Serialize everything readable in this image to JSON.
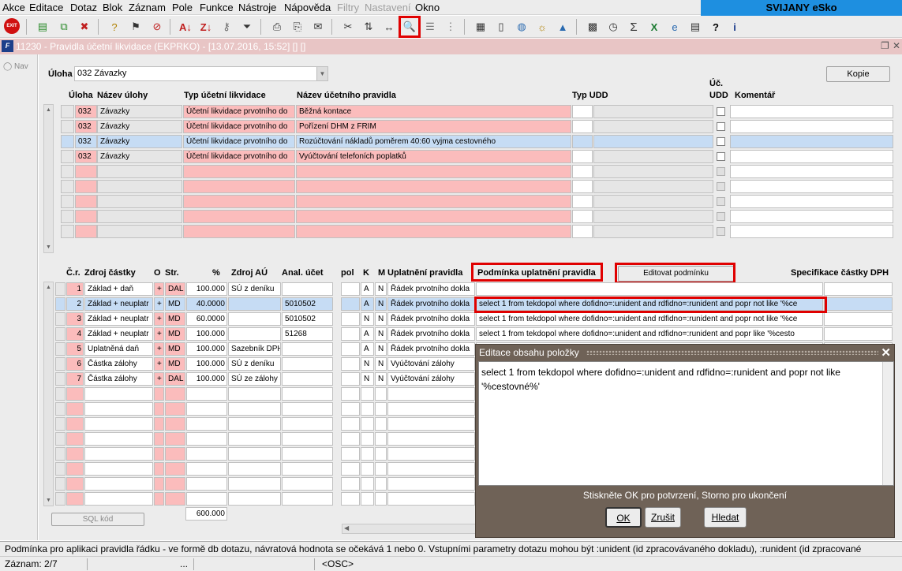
{
  "menu": [
    "Akce",
    "Editace",
    "Dotaz",
    "Blok",
    "Záznam",
    "Pole",
    "Funkce",
    "Nástroje",
    "Nápověda",
    "Filtry",
    "Nastavení",
    "Okno"
  ],
  "brand": "SVIJANY eSko",
  "window": {
    "title": "11230 - Pravidla účetní likvidace (EKPRKO) - [13.07.2016, 15:52]  []  []",
    "nav": "Nav"
  },
  "uloha": {
    "label": "Úloha",
    "value": "032 Závazky",
    "kopie": "Kopie"
  },
  "rules_table": {
    "headers": {
      "uloha": "Úloha",
      "nazev_ulohy": "Název úlohy",
      "typ": "Typ účetní likvidace",
      "nazev_pravidla": "Název účetního pravidla",
      "typ_udd": "Typ UDD",
      "uc_udd_1": "Úč.",
      "uc_udd_2": "UDD",
      "komentar": "Komentář"
    },
    "rows": [
      {
        "uloha": "032",
        "nazev": "Závazky",
        "typ": "Účetní likvidace prvotního do",
        "pravidlo": "Běžná kontace"
      },
      {
        "uloha": "032",
        "nazev": "Závazky",
        "typ": "Účetní likvidace prvotního do",
        "pravidlo": "Pořízení DHM z FRIM"
      },
      {
        "uloha": "032",
        "nazev": "Závazky",
        "typ": "Účetní likvidace prvotního do",
        "pravidlo": "Rozúčtování nákladů poměrem 40:60 vyjma cestovného"
      },
      {
        "uloha": "032",
        "nazev": "Závazky",
        "typ": "Účetní likvidace prvotního do",
        "pravidlo": "Vyúčtování telefoních poplatků"
      }
    ]
  },
  "lines_table": {
    "headers": {
      "cr": "Č.r.",
      "zdroj": "Zdroj částky",
      "o": "O",
      "str": "Str.",
      "pct": "%",
      "zdroj_au": "Zdroj AÚ",
      "anal": "Anal. účet",
      "pol": "pol",
      "k": "K",
      "m": "M",
      "uplatneni": "Uplatnění pravidla",
      "podminka": "Podmínka uplatnění pravidla",
      "editovat": "Editovat podmínku",
      "specifikace": "Specifikace částky DPH"
    },
    "rows": [
      {
        "cr": "1",
        "zdroj": "Základ + daň",
        "o": "+",
        "str": "DAL",
        "pct": "100.000",
        "zdroj_au": "SÚ z deníku",
        "anal": "",
        "k": "A",
        "m": "N",
        "upl": "Řádek prvotního dokla",
        "podm": ""
      },
      {
        "cr": "2",
        "zdroj": "Základ + neuplatr",
        "o": "+",
        "str": "MD",
        "pct": "40.0000",
        "zdroj_au": "",
        "anal": "5010502",
        "k": "A",
        "m": "N",
        "upl": "Řádek prvotního dokla",
        "podm": "select 1 from tekdopol where dofidno=:unident and rdfidno=:runident and popr not like '%ce"
      },
      {
        "cr": "3",
        "zdroj": "Základ + neuplatr",
        "o": "+",
        "str": "MD",
        "pct": "60.0000",
        "zdroj_au": "",
        "anal": "5010502",
        "k": "N",
        "m": "N",
        "upl": "Řádek prvotního dokla",
        "podm": "select 1 from tekdopol where dofidno=:unident and rdfidno=:runident and popr not like '%ce"
      },
      {
        "cr": "4",
        "zdroj": "Základ + neuplatr",
        "o": "+",
        "str": "MD",
        "pct": "100.000",
        "zdroj_au": "",
        "anal": "51268",
        "k": "A",
        "m": "N",
        "upl": "Řádek prvotního dokla",
        "podm": "select 1 from tekdopol where dofidno=:unident and rdfidno=:runident and popr like '%cesto"
      },
      {
        "cr": "5",
        "zdroj": "Uplatněná daň",
        "o": "+",
        "str": "MD",
        "pct": "100.000",
        "zdroj_au": "Sazebník DPH",
        "anal": "",
        "k": "A",
        "m": "N",
        "upl": "Řádek prvotního dokla",
        "podm": ""
      },
      {
        "cr": "6",
        "zdroj": "Částka zálohy",
        "o": "+",
        "str": "MD",
        "pct": "100.000",
        "zdroj_au": "SÚ z deníku",
        "anal": "",
        "k": "N",
        "m": "N",
        "upl": "Vyúčtování zálohy",
        "podm": ""
      },
      {
        "cr": "7",
        "zdroj": "Částka zálohy",
        "o": "+",
        "str": "DAL",
        "pct": "100.000",
        "zdroj_au": "SÚ ze zálohy",
        "anal": "",
        "k": "N",
        "m": "N",
        "upl": "Vyúčtování zálohy",
        "podm": ""
      }
    ],
    "sum": "600.000",
    "sql_button": "SQL kód"
  },
  "popup": {
    "title": "Editace obsahu položky",
    "text": "select 1 from tekdopol where dofidno=:unident and rdfidno=:runident and popr not like '%cestovné%'",
    "message": "Stiskněte OK pro potvrzení, Storno pro ukončení",
    "ok": "OK",
    "cancel": "Zrušit",
    "find": "Hledat"
  },
  "status": {
    "hint": "Podmínka pro aplikaci pravidla řádku - ve formě db dotazu, návratová hodnota se očekává 1 nebo 0. Vstupními parametry dotazu mohou být :unident (id zpracovávaného dokladu), :runident (id zpracované",
    "record": "Záznam: 2/7",
    "dots": "...",
    "osc": "<OSC>"
  }
}
